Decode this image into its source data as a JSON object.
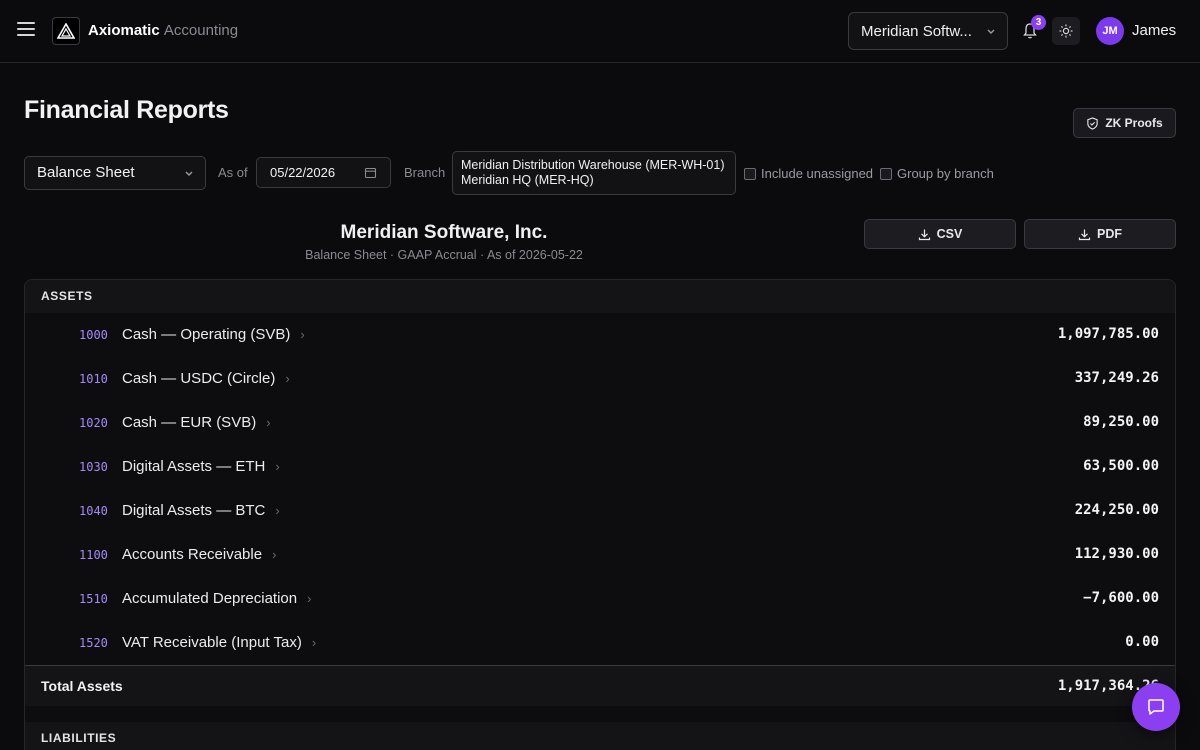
{
  "header": {
    "brand_primary": "Axiomatic",
    "brand_secondary": "Accounting",
    "company_select": "Meridian Softw...",
    "notification_count": "3",
    "user_initials": "JM",
    "user_name": "James"
  },
  "page": {
    "title": "Financial Reports",
    "zk_button": "ZK Proofs"
  },
  "filters": {
    "report_type": "Balance Sheet",
    "as_of_label": "As of",
    "date_value": "05/22/2026",
    "branch_label": "Branch",
    "branches": [
      "Meridian Distribution Warehouse (MER-WH-01)",
      "Meridian HQ (MER-HQ)"
    ],
    "include_unassigned": "Include unassigned",
    "group_by_branch": "Group by branch"
  },
  "report": {
    "company": "Meridian Software, Inc.",
    "subtitle": "Balance Sheet · GAAP Accrual · As of 2026-05-22",
    "csv_label": "CSV",
    "pdf_label": "PDF",
    "assets_heading": "ASSETS",
    "assets": [
      {
        "code": "1000",
        "name": "Cash — Operating (SVB)",
        "amount": "1,097,785.00"
      },
      {
        "code": "1010",
        "name": "Cash — USDC (Circle)",
        "amount": "337,249.26"
      },
      {
        "code": "1020",
        "name": "Cash — EUR (SVB)",
        "amount": "89,250.00"
      },
      {
        "code": "1030",
        "name": "Digital Assets — ETH",
        "amount": "63,500.00"
      },
      {
        "code": "1040",
        "name": "Digital Assets — BTC",
        "amount": "224,250.00"
      },
      {
        "code": "1100",
        "name": "Accounts Receivable",
        "amount": "112,930.00"
      },
      {
        "code": "1510",
        "name": "Accumulated Depreciation",
        "amount": "−7,600.00"
      },
      {
        "code": "1520",
        "name": "VAT Receivable (Input Tax)",
        "amount": "0.00"
      }
    ],
    "total_assets_label": "Total Assets",
    "total_assets_amount": "1,917,364.26",
    "liabilities_heading": "LIABILITIES"
  },
  "colors": {
    "accent": "#8b3ff0",
    "account_code": "#a38bf5",
    "background": "#0b0b0d"
  }
}
